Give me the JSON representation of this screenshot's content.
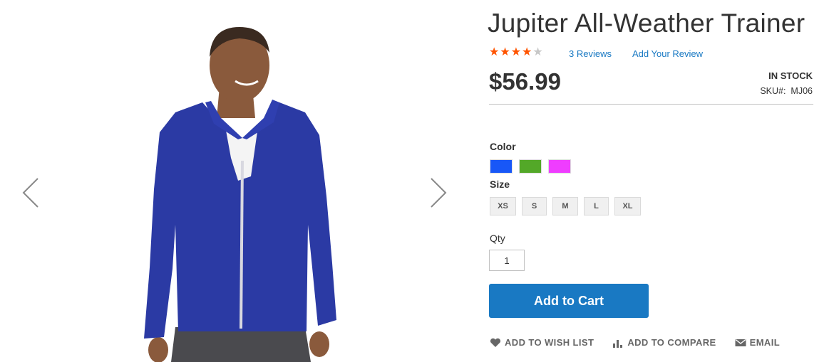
{
  "product": {
    "title": "Jupiter All-Weather Trainer",
    "rating": 4,
    "rating_max": 5,
    "reviews_link": "3 Reviews",
    "add_review_link": "Add Your Review",
    "price": "$56.99",
    "stock_status": "IN STOCK",
    "sku_label": "SKU#:",
    "sku_value": "MJ06"
  },
  "colors": {
    "star_filled": "#ff5501",
    "star_empty": "#c7c7c7",
    "link": "#1979c3",
    "cart_button": "#1979c3"
  },
  "options": {
    "color_label": "Color",
    "swatches": [
      {
        "name": "Blue",
        "hex": "#1857f7"
      },
      {
        "name": "Green",
        "hex": "#53a828"
      },
      {
        "name": "Purple",
        "hex": "#ef3dff"
      }
    ],
    "size_label": "Size",
    "sizes": [
      "XS",
      "S",
      "M",
      "L",
      "XL"
    ]
  },
  "qty": {
    "label": "Qty",
    "value": "1"
  },
  "buttons": {
    "add_to_cart": "Add to Cart",
    "wishlist": "ADD TO WISH LIST",
    "compare": "ADD TO COMPARE",
    "email": "EMAIL"
  },
  "gallery": {
    "prev_icon": "chevron-left-icon",
    "next_icon": "chevron-right-icon"
  }
}
